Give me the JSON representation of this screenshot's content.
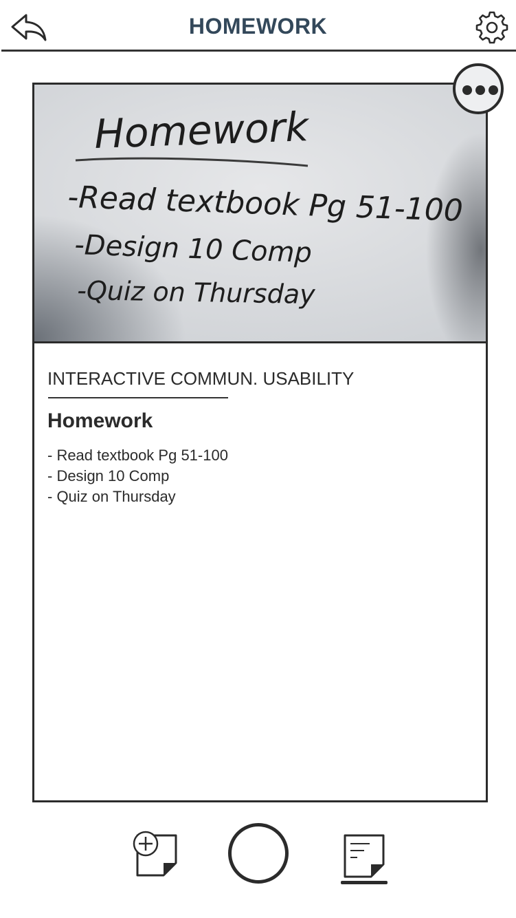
{
  "header": {
    "title": "HOMEWORK",
    "back_icon": "reply-arrow-icon",
    "settings_icon": "gear-icon"
  },
  "card": {
    "photo_handwriting": {
      "heading": "Homework",
      "lines": [
        "-Read textbook Pg 51-100",
        "-Design 10 Comp",
        "-Quiz on Thursday"
      ]
    },
    "more_icon": "more-horizontal-icon",
    "course": "INTERACTIVE COMMUN. USABILITY",
    "note_title": "Homework",
    "note_lines": [
      "- Read textbook Pg 51-100",
      "- Design 10 Comp",
      "- Quiz on Thursday"
    ]
  },
  "toolbar": {
    "add_note_icon": "add-note-icon",
    "capture_icon": "capture-circle-icon",
    "notes_icon": "note-list-icon"
  },
  "colors": {
    "title": "#33485a",
    "ink": "#2b2b2b",
    "background": "#ffffff"
  }
}
